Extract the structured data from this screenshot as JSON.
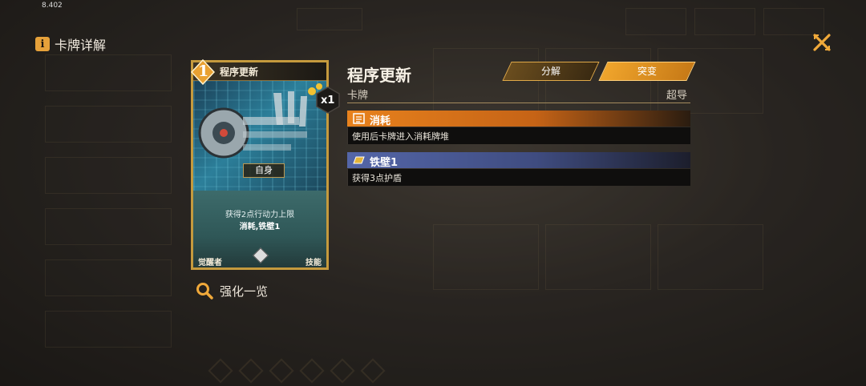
{
  "fps": "8.402",
  "page_title": "卡牌详解",
  "card": {
    "cost": "1",
    "name": "程序更新",
    "quantity": "x1",
    "target": "自身",
    "desc_line1": "获得2点行动力上限",
    "desc_line2": "消耗,铁壁1",
    "footer_left": "觉醒者",
    "footer_right": "技能"
  },
  "detail": {
    "title": "程序更新",
    "type": "卡牌",
    "role": "超导",
    "decompose_label": "分解",
    "breakthrough_label": "突变"
  },
  "keywords": [
    {
      "name": "消耗",
      "description": "使用后卡牌进入消耗牌堆",
      "icon": "document-icon",
      "color": "#e8821d"
    },
    {
      "name": "铁壁1",
      "description": "获得3点护盾",
      "icon": "shield-plate-icon",
      "color": "#5466a8"
    }
  ],
  "upgrade_label": "强化一览",
  "colors": {
    "accent": "#e6a13a",
    "card_frame": "#c59a3d"
  }
}
